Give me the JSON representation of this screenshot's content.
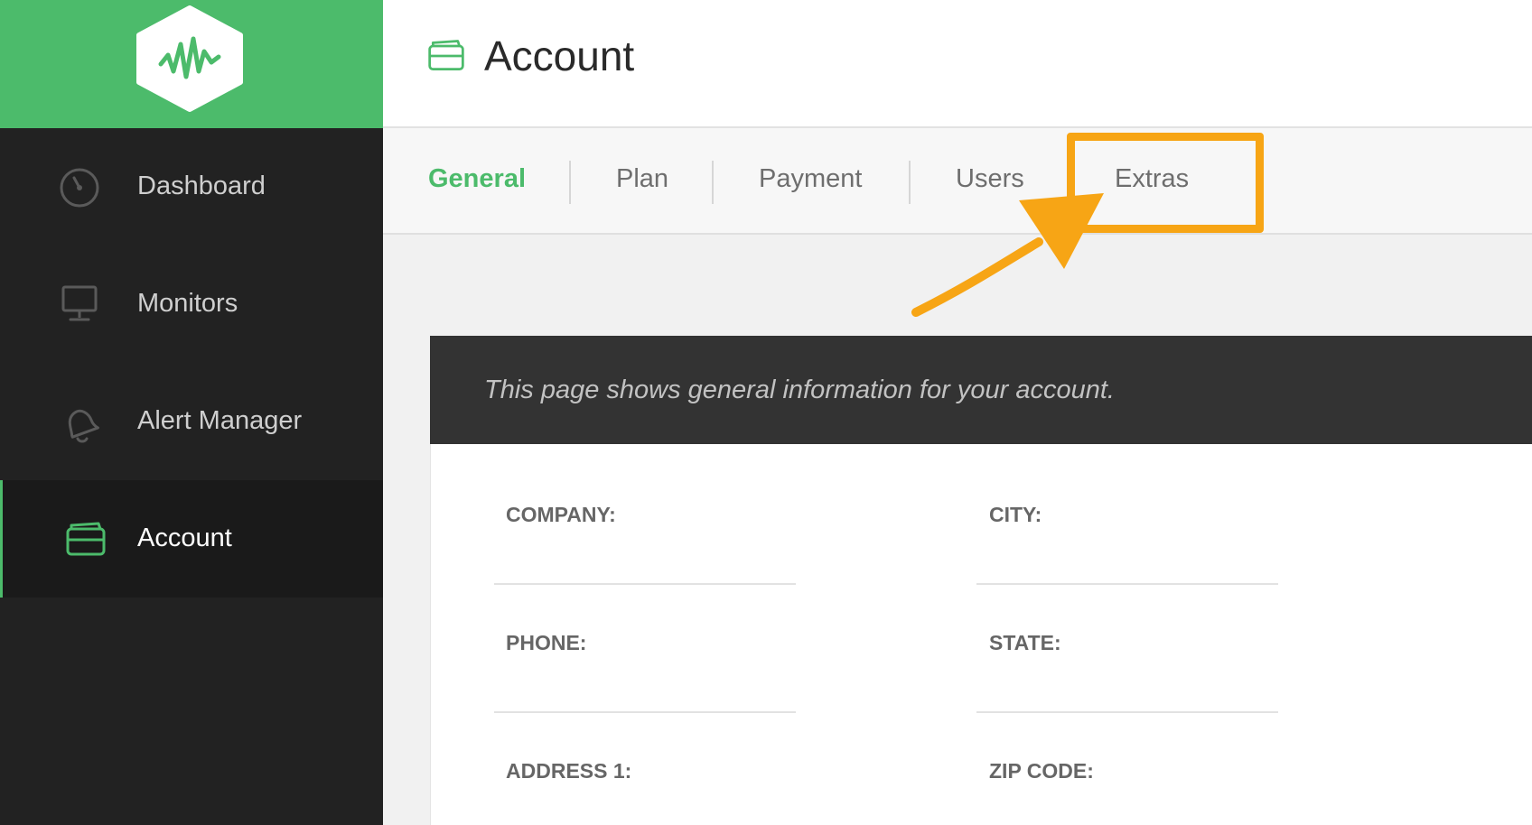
{
  "app": {
    "title": "Account"
  },
  "sidebar": {
    "items": [
      {
        "label": "Dashboard",
        "icon": "speedometer-icon"
      },
      {
        "label": "Monitors",
        "icon": "monitor-icon"
      },
      {
        "label": "Alert Manager",
        "icon": "bell-icon"
      },
      {
        "label": "Account",
        "icon": "wallet-icon",
        "active": true
      }
    ]
  },
  "tabs": {
    "items": [
      "General",
      "Plan",
      "Payment",
      "Users",
      "Extras"
    ],
    "active": "General",
    "highlighted": "Extras"
  },
  "card": {
    "description": "This page shows general information for your account.",
    "fields": {
      "company": "COMPANY:",
      "city": "CITY:",
      "phone": "PHONE:",
      "state": "STATE:",
      "address1": "ADDRESS 1:",
      "zip": "ZIP CODE:"
    }
  },
  "colors": {
    "brand_green": "#4cbb6b",
    "sidebar_bg": "#222222",
    "highlight": "#f7a515"
  }
}
